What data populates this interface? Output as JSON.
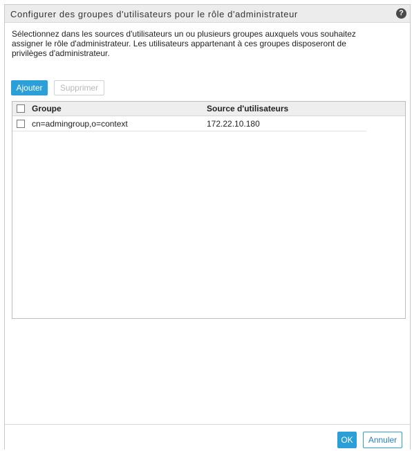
{
  "dialog": {
    "title": "Configurer des groupes d'utilisateurs pour le rôle d'administrateur",
    "help_icon": "help-icon",
    "help_glyph": "?",
    "description_lines": [
      "Sélectionnez dans les sources d'utilisateurs un ou plusieurs groupes auxquels vous souhaitez",
      "assigner le rôle d'administrateur. Les utilisateurs appartenant à ces groupes disposeront de",
      "privilèges d'administrateur."
    ]
  },
  "toolbar": {
    "add_label": "Ajouter",
    "delete_label": "Supprimer"
  },
  "table": {
    "columns": [
      "Groupe",
      "Source d'utilisateurs"
    ],
    "rows": [
      [
        "cn=admingroup,o=context",
        "172.22.10.180"
      ]
    ]
  },
  "footer": {
    "ok_label": "OK",
    "cancel_label": "Annuler"
  },
  "colors": {
    "accent": "#2a9fd8",
    "titlebar_bg": "#ececec"
  }
}
